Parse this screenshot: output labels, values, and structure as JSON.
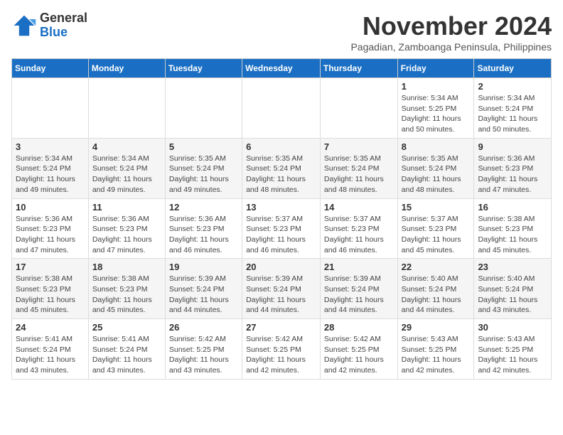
{
  "header": {
    "logo_general": "General",
    "logo_blue": "Blue",
    "month_title": "November 2024",
    "location": "Pagadian, Zamboanga Peninsula, Philippines"
  },
  "calendar": {
    "days_of_week": [
      "Sunday",
      "Monday",
      "Tuesday",
      "Wednesday",
      "Thursday",
      "Friday",
      "Saturday"
    ],
    "weeks": [
      [
        {
          "day": "",
          "info": ""
        },
        {
          "day": "",
          "info": ""
        },
        {
          "day": "",
          "info": ""
        },
        {
          "day": "",
          "info": ""
        },
        {
          "day": "",
          "info": ""
        },
        {
          "day": "1",
          "info": "Sunrise: 5:34 AM\nSunset: 5:25 PM\nDaylight: 11 hours\nand 50 minutes."
        },
        {
          "day": "2",
          "info": "Sunrise: 5:34 AM\nSunset: 5:24 PM\nDaylight: 11 hours\nand 50 minutes."
        }
      ],
      [
        {
          "day": "3",
          "info": "Sunrise: 5:34 AM\nSunset: 5:24 PM\nDaylight: 11 hours\nand 49 minutes."
        },
        {
          "day": "4",
          "info": "Sunrise: 5:34 AM\nSunset: 5:24 PM\nDaylight: 11 hours\nand 49 minutes."
        },
        {
          "day": "5",
          "info": "Sunrise: 5:35 AM\nSunset: 5:24 PM\nDaylight: 11 hours\nand 49 minutes."
        },
        {
          "day": "6",
          "info": "Sunrise: 5:35 AM\nSunset: 5:24 PM\nDaylight: 11 hours\nand 48 minutes."
        },
        {
          "day": "7",
          "info": "Sunrise: 5:35 AM\nSunset: 5:24 PM\nDaylight: 11 hours\nand 48 minutes."
        },
        {
          "day": "8",
          "info": "Sunrise: 5:35 AM\nSunset: 5:24 PM\nDaylight: 11 hours\nand 48 minutes."
        },
        {
          "day": "9",
          "info": "Sunrise: 5:36 AM\nSunset: 5:23 PM\nDaylight: 11 hours\nand 47 minutes."
        }
      ],
      [
        {
          "day": "10",
          "info": "Sunrise: 5:36 AM\nSunset: 5:23 PM\nDaylight: 11 hours\nand 47 minutes."
        },
        {
          "day": "11",
          "info": "Sunrise: 5:36 AM\nSunset: 5:23 PM\nDaylight: 11 hours\nand 47 minutes."
        },
        {
          "day": "12",
          "info": "Sunrise: 5:36 AM\nSunset: 5:23 PM\nDaylight: 11 hours\nand 46 minutes."
        },
        {
          "day": "13",
          "info": "Sunrise: 5:37 AM\nSunset: 5:23 PM\nDaylight: 11 hours\nand 46 minutes."
        },
        {
          "day": "14",
          "info": "Sunrise: 5:37 AM\nSunset: 5:23 PM\nDaylight: 11 hours\nand 46 minutes."
        },
        {
          "day": "15",
          "info": "Sunrise: 5:37 AM\nSunset: 5:23 PM\nDaylight: 11 hours\nand 45 minutes."
        },
        {
          "day": "16",
          "info": "Sunrise: 5:38 AM\nSunset: 5:23 PM\nDaylight: 11 hours\nand 45 minutes."
        }
      ],
      [
        {
          "day": "17",
          "info": "Sunrise: 5:38 AM\nSunset: 5:23 PM\nDaylight: 11 hours\nand 45 minutes."
        },
        {
          "day": "18",
          "info": "Sunrise: 5:38 AM\nSunset: 5:23 PM\nDaylight: 11 hours\nand 45 minutes."
        },
        {
          "day": "19",
          "info": "Sunrise: 5:39 AM\nSunset: 5:24 PM\nDaylight: 11 hours\nand 44 minutes."
        },
        {
          "day": "20",
          "info": "Sunrise: 5:39 AM\nSunset: 5:24 PM\nDaylight: 11 hours\nand 44 minutes."
        },
        {
          "day": "21",
          "info": "Sunrise: 5:39 AM\nSunset: 5:24 PM\nDaylight: 11 hours\nand 44 minutes."
        },
        {
          "day": "22",
          "info": "Sunrise: 5:40 AM\nSunset: 5:24 PM\nDaylight: 11 hours\nand 44 minutes."
        },
        {
          "day": "23",
          "info": "Sunrise: 5:40 AM\nSunset: 5:24 PM\nDaylight: 11 hours\nand 43 minutes."
        }
      ],
      [
        {
          "day": "24",
          "info": "Sunrise: 5:41 AM\nSunset: 5:24 PM\nDaylight: 11 hours\nand 43 minutes."
        },
        {
          "day": "25",
          "info": "Sunrise: 5:41 AM\nSunset: 5:24 PM\nDaylight: 11 hours\nand 43 minutes."
        },
        {
          "day": "26",
          "info": "Sunrise: 5:42 AM\nSunset: 5:25 PM\nDaylight: 11 hours\nand 43 minutes."
        },
        {
          "day": "27",
          "info": "Sunrise: 5:42 AM\nSunset: 5:25 PM\nDaylight: 11 hours\nand 42 minutes."
        },
        {
          "day": "28",
          "info": "Sunrise: 5:42 AM\nSunset: 5:25 PM\nDaylight: 11 hours\nand 42 minutes."
        },
        {
          "day": "29",
          "info": "Sunrise: 5:43 AM\nSunset: 5:25 PM\nDaylight: 11 hours\nand 42 minutes."
        },
        {
          "day": "30",
          "info": "Sunrise: 5:43 AM\nSunset: 5:25 PM\nDaylight: 11 hours\nand 42 minutes."
        }
      ]
    ]
  }
}
